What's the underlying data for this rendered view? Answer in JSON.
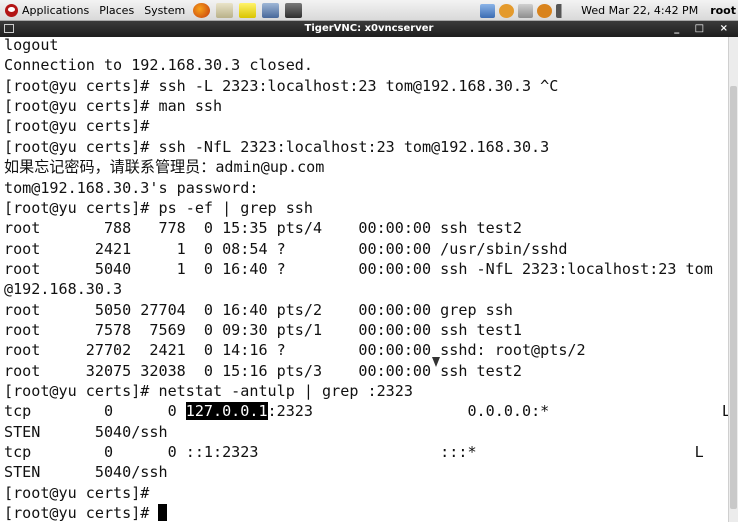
{
  "panel": {
    "menus": [
      "Applications",
      "Places",
      "System"
    ],
    "launchers": [
      "firefox-icon",
      "tools-icon",
      "notes-icon",
      "monitor-icon",
      "camera-icon"
    ],
    "tray_icons": [
      "network-icon",
      "info-icon",
      "update-icon",
      "help-icon",
      "volume-icon"
    ],
    "clock": "Wed Mar 22,  4:42 PM",
    "user": "root"
  },
  "window": {
    "title": "TigerVNC: x0vncserver",
    "buttons": "_ □ ×"
  },
  "terminal": {
    "lines": [
      "logout",
      "Connection to 192.168.30.3 closed.",
      "[root@yu certs]# ssh -L 2323:localhost:23 tom@192.168.30.3 ^C",
      "[root@yu certs]# man ssh",
      "[root@yu certs]#",
      "[root@yu certs]# ssh -NfL 2323:localhost:23 tom@192.168.30.3",
      "如果忘记密码，请联系管理员：admin@up.com",
      "tom@192.168.30.3's password:",
      "[root@yu certs]# ps -ef | grep ssh",
      "root       788   778  0 15:35 pts/4    00:00:00 ssh test2",
      "root      2421     1  0 08:54 ?        00:00:00 /usr/sbin/sshd",
      "root      5040     1  0 16:40 ?        00:00:00 ssh -NfL 2323:localhost:23 tom",
      "@192.168.30.3",
      "root      5050 27704  0 16:40 pts/2    00:00:00 grep ssh",
      "root      7578  7569  0 09:30 pts/1    00:00:00 ssh test1",
      "root     27702  2421  0 14:16 ?        00:00:00 sshd: root@pts/2",
      "root     32075 32038  0 15:16 pts/3    00:00:00 ssh test2",
      "[root@yu certs]# netstat -antulp | grep :2323",
      "tcp        0      0 ",
      "STEN      5040/ssh",
      "tcp        0      0 ::1:2323                    :::*                        L",
      "STEN      5040/ssh",
      "[root@yu certs]#",
      "[root@yu certs]# "
    ],
    "netstat_highlight": "127.0.0.1",
    "netstat_rest": ":2323                 0.0.0.0:*                   L"
  }
}
